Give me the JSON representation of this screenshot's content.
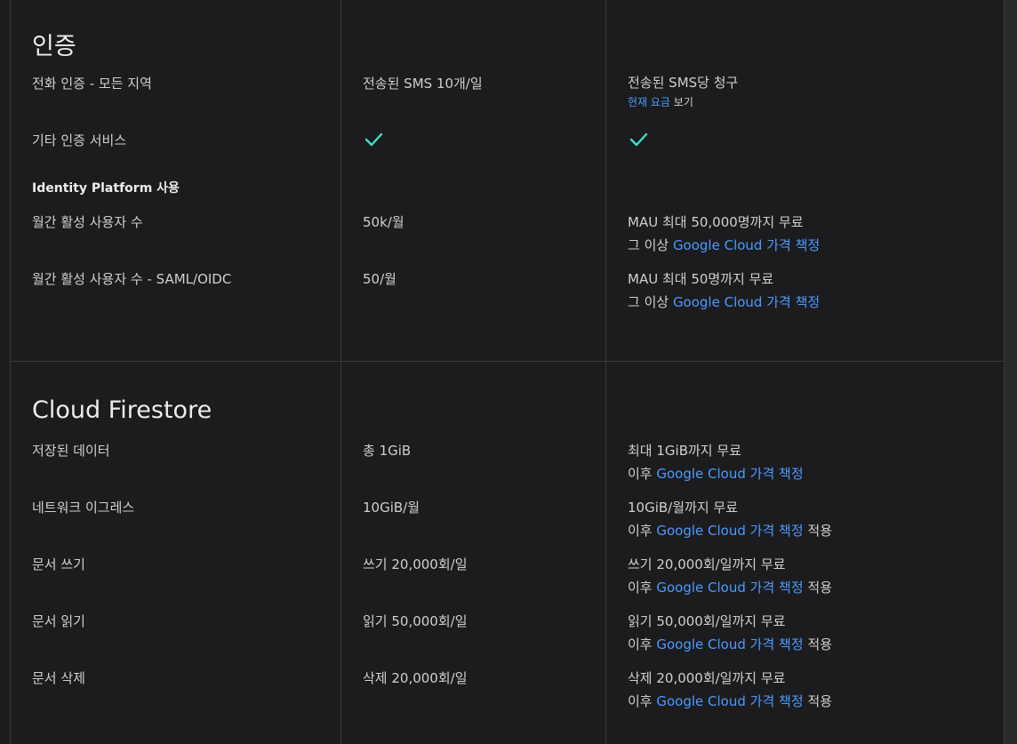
{
  "auth": {
    "title": "인증",
    "rows": [
      {
        "label": "전화 인증 - 모든 지역",
        "free": "전송된 SMS 10개/일",
        "blaze_line1": "전송된 SMS당 청구",
        "blaze_link": "현재 요금",
        "blaze_after": " 보기"
      },
      {
        "label": "기타 인증 서비스"
      },
      {
        "label": "Identity Platform 사용"
      },
      {
        "label": "월간 활성 사용자 수",
        "free": "50k/월",
        "blaze_line1": "MAU 최대 50,000명까지 무료",
        "blaze_prefix": "그 이상 ",
        "blaze_link": "Google Cloud 가격 책정"
      },
      {
        "label": "월간 활성 사용자 수 - SAML/OIDC",
        "free": "50/월",
        "blaze_line1": "MAU 최대 50명까지 무료",
        "blaze_prefix": "그 이상 ",
        "blaze_link": "Google Cloud 가격 책정"
      }
    ]
  },
  "firestore": {
    "title": "Cloud Firestore",
    "rows": [
      {
        "label": "저장된 데이터",
        "free": "총 1GiB",
        "blaze_line1": "최대 1GiB까지 무료",
        "blaze_prefix": "이후 ",
        "blaze_link": "Google Cloud 가격 책정",
        "blaze_suffix": ""
      },
      {
        "label": "네트워크 이그레스",
        "free": "10GiB/월",
        "blaze_line1": "10GiB/월까지 무료",
        "blaze_prefix": "이후 ",
        "blaze_link": "Google Cloud 가격 책정",
        "blaze_suffix": " 적용"
      },
      {
        "label": "문서 쓰기",
        "free": "쓰기 20,000회/일",
        "blaze_line1": "쓰기 20,000회/일까지 무료",
        "blaze_prefix": "이후 ",
        "blaze_link": "Google Cloud 가격 책정",
        "blaze_suffix": " 적용"
      },
      {
        "label": "문서 읽기",
        "free": "읽기 50,000회/일",
        "blaze_line1": "읽기 50,000회/일까지 무료",
        "blaze_prefix": "이후 ",
        "blaze_link": "Google Cloud 가격 책정",
        "blaze_suffix": " 적용"
      },
      {
        "label": "문서 삭제",
        "free": "삭제 20,000회/일",
        "blaze_line1": "삭제 20,000회/일까지 무료",
        "blaze_prefix": "이후 ",
        "blaze_link": "Google Cloud 가격 책정",
        "blaze_suffix": " 적용"
      }
    ]
  },
  "icons": {
    "check": "check-icon"
  },
  "colors": {
    "background": "#1c1c1e",
    "link": "#4c9aff",
    "check": "#3ee0c8",
    "divider": "#3a3a3c"
  }
}
